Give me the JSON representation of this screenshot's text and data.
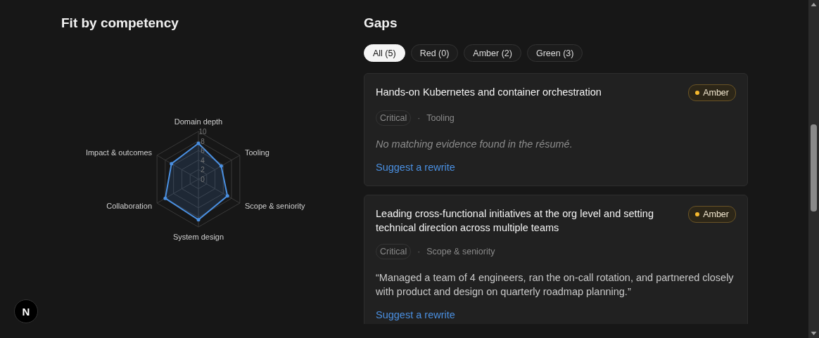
{
  "fit": {
    "title": "Fit by competency",
    "chart_data": {
      "type": "radar",
      "categories": [
        "Domain depth",
        "Tooling",
        "Scope & seniority",
        "System design",
        "Collaboration",
        "Impact & outcomes"
      ],
      "series": [
        {
          "color": "#4a90e2",
          "values": [
            7.5,
            5.5,
            7,
            8.5,
            8,
            6.5
          ]
        }
      ],
      "ylim": [
        0,
        10
      ],
      "yticks": [
        0,
        2,
        4,
        6,
        8,
        10
      ]
    }
  },
  "gaps": {
    "title": "Gaps",
    "filters": [
      {
        "label": "All (5)",
        "selected": true
      },
      {
        "label": "Red (0)",
        "selected": false
      },
      {
        "label": "Amber (2)",
        "selected": false
      },
      {
        "label": "Green (3)",
        "selected": false
      }
    ],
    "items": [
      {
        "title": "Hands-on Kubernetes and container orchestration",
        "status": "Amber",
        "color": "#f5b82e",
        "priority": "Critical",
        "separator": "·",
        "category": "Tooling",
        "evidence": {
          "kind": "missing",
          "text": "No matching evidence found in the résumé."
        },
        "action": "Suggest a rewrite"
      },
      {
        "title": "Leading cross-functional initiatives at the org level and setting technical direction across multiple teams",
        "status": "Amber",
        "color": "#f5b82e",
        "priority": "Critical",
        "separator": "·",
        "category": "Scope & seniority",
        "evidence": {
          "kind": "quote",
          "text": "“Managed a team of 4 engineers, ran the on-call rotation, and partnered closely with product and design on quarterly roadmap planning.”"
        },
        "action": "Suggest a rewrite"
      }
    ]
  },
  "dev_badge": {
    "label": "N"
  }
}
